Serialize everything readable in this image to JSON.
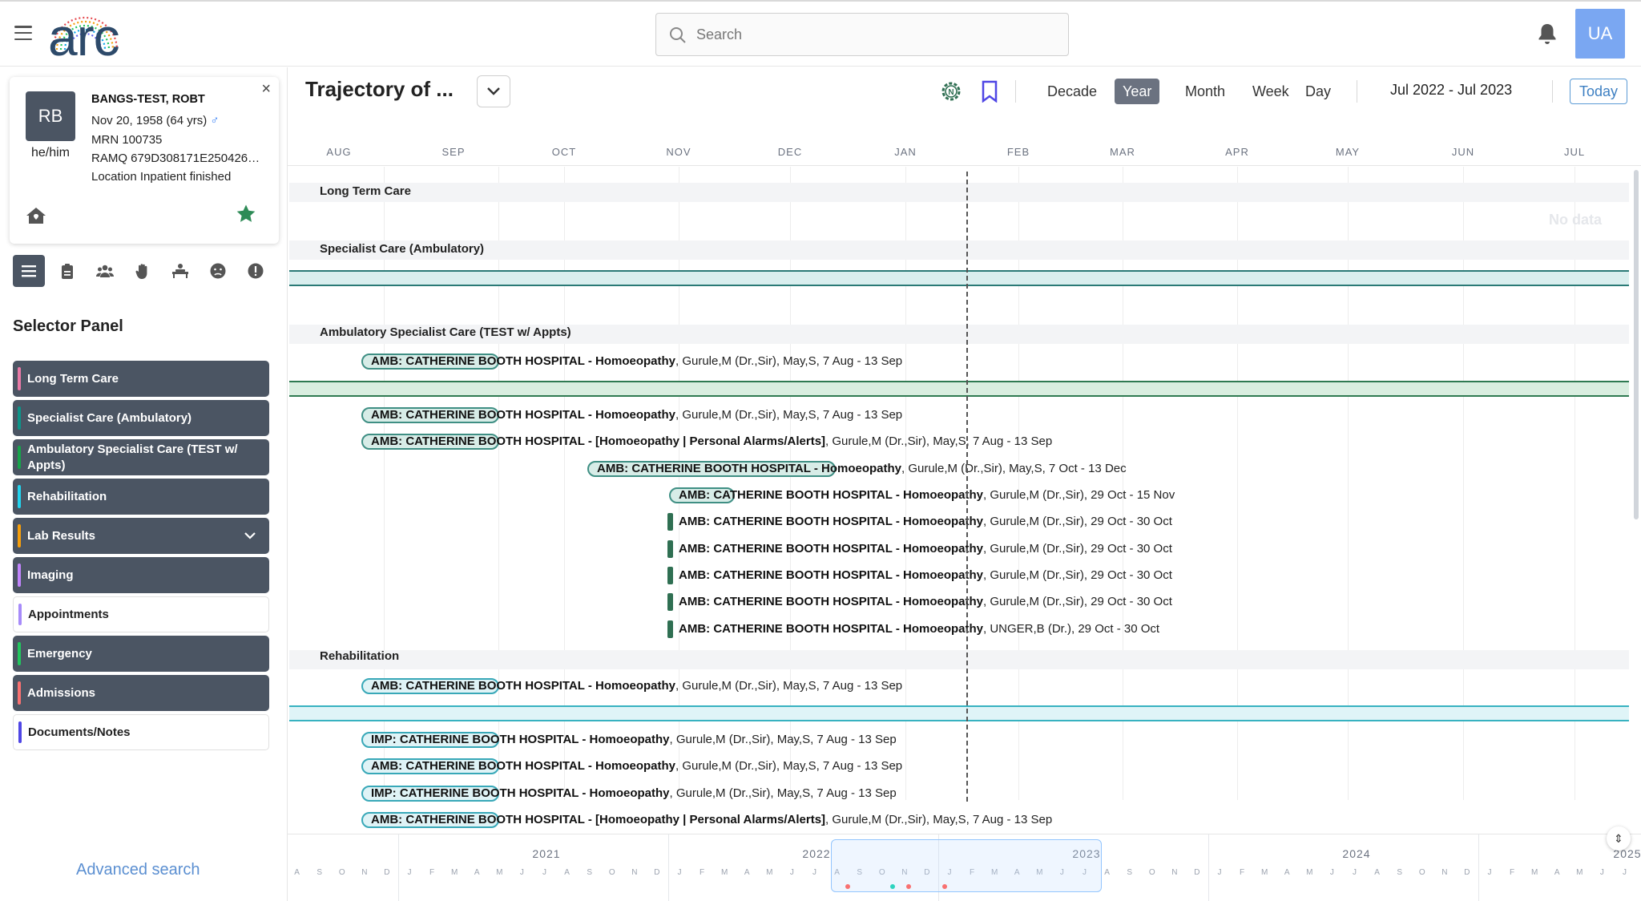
{
  "topbar": {
    "logo_text": "arc",
    "search_placeholder": "Search",
    "user_initials": "UA"
  },
  "patient": {
    "initials": "RB",
    "pronouns": "he/him",
    "name": "BANGS-TEST, ROBT",
    "dob": "Nov 20, 1958 (64 yrs)",
    "sex_symbol": "♂",
    "mrn": "MRN 100735",
    "ramq": "RAMQ 679D308171E250426…",
    "location": "Location Inpatient finished",
    "close_label": "×"
  },
  "sidebar": {
    "title": "Selector Panel",
    "advanced_search": "Advanced search",
    "items": [
      {
        "label": "Long Term Care",
        "color": "#e879a6",
        "style": "dark"
      },
      {
        "label": "Specialist Care (Ambulatory)",
        "color": "#0d9488",
        "style": "dark"
      },
      {
        "label": "Ambulatory Specialist Care (TEST w/ Appts)",
        "color": "#16a34a",
        "style": "dark"
      },
      {
        "label": "Rehabilitation",
        "color": "#22d3ee",
        "style": "dark"
      },
      {
        "label": "Lab Results",
        "color": "#f59e0b",
        "style": "dark"
      },
      {
        "label": "Imaging",
        "color": "#c084fc",
        "style": "dark"
      },
      {
        "label": "Appointments",
        "color": "#a78bfa",
        "style": "light"
      },
      {
        "label": "Emergency",
        "color": "#22c55e",
        "style": "dark"
      },
      {
        "label": "Admissions",
        "color": "#f87171",
        "style": "dark"
      },
      {
        "label": "Documents/Notes",
        "color": "#4f46e5",
        "style": "light"
      }
    ]
  },
  "toolbar": {
    "title": "Trajectory of ...",
    "zoom": [
      "Decade",
      "Year",
      "Month",
      "Week",
      "Day"
    ],
    "active_zoom": "Year",
    "range": "Jul 2022 - Jul 2023",
    "today_label": "Today"
  },
  "timeline": {
    "months": [
      "AUG",
      "SEP",
      "OCT",
      "NOV",
      "DEC",
      "JAN",
      "FEB",
      "MAR",
      "APR",
      "MAY",
      "JUN",
      "JUL"
    ],
    "no_data": "No data",
    "groups": [
      {
        "label": "Long Term Care"
      },
      {
        "label": "Specialist Care (Ambulatory)"
      },
      {
        "label": "Ambulatory Specialist Care (TEST w/ Appts)"
      },
      {
        "label": "Rehabilitation"
      }
    ],
    "events": [
      {
        "title": "AMB: CATHERINE BOOTH HOSPITAL - Homoeopathy",
        "detail": ", Gurule,M (Dr.,Sir), May,S, 7 Aug - 13 Sep",
        "color": "#3f8f84",
        "fill": "#d7ece7"
      },
      {
        "title": "AMB: CATHERINE BOOTH HOSPITAL - Homoeopathy",
        "detail": ", Gurule,M (Dr.,Sir), May,S, 7 Aug - 13 Sep",
        "color": "#3f8f84",
        "fill": "#d7ece7"
      },
      {
        "title": "AMB: CATHERINE BOOTH HOSPITAL - [Homoeopathy | Personal Alarms/Alerts]",
        "detail": ", Gurule,M (Dr.,Sir), May,S, 7 Aug - 13 Sep",
        "color": "#3f8f84",
        "fill": "#d7ece7"
      },
      {
        "title": "AMB: CATHERINE BOOTH HOSPITAL - Homoeopathy",
        "detail": ", Gurule,M (Dr.,Sir), May,S, 7 Oct - 13 Dec",
        "color": "#3f8f84",
        "fill": "#d7ece7"
      },
      {
        "title": "AMB: CATHERINE BOOTH HOSPITAL - Homoeopathy",
        "detail": ", Gurule,M (Dr.,Sir), 29 Oct - 15 Nov",
        "color": "#3f8f84",
        "fill": "#d7ece7"
      },
      {
        "title": "AMB: CATHERINE BOOTH HOSPITAL - Homoeopathy",
        "detail": ", Gurule,M (Dr.,Sir), 29 Oct - 30 Oct",
        "color": "#2f6f52",
        "fill": "#2f6f52"
      },
      {
        "title": "AMB: CATHERINE BOOTH HOSPITAL - Homoeopathy",
        "detail": ", Gurule,M (Dr.,Sir), 29 Oct - 30 Oct",
        "color": "#2f6f52",
        "fill": "#2f6f52"
      },
      {
        "title": "AMB: CATHERINE BOOTH HOSPITAL - Homoeopathy",
        "detail": ", Gurule,M (Dr.,Sir), 29 Oct - 30 Oct",
        "color": "#2f6f52",
        "fill": "#2f6f52"
      },
      {
        "title": "AMB: CATHERINE BOOTH HOSPITAL - Homoeopathy",
        "detail": ", Gurule,M (Dr.,Sir), 29 Oct - 30 Oct",
        "color": "#2f6f52",
        "fill": "#2f6f52"
      },
      {
        "title": "AMB: CATHERINE BOOTH HOSPITAL - Homoeopathy",
        "detail": ", UNGER,B (Dr.), 29 Oct - 30 Oct",
        "color": "#2f6f52",
        "fill": "#2f6f52"
      },
      {
        "title": "AMB: CATHERINE BOOTH HOSPITAL - Homoeopathy",
        "detail": ", Gurule,M (Dr.,Sir), May,S, 7 Aug - 13 Sep",
        "color": "#38a8b8",
        "fill": "#dff3f6"
      },
      {
        "title": "IMP: CATHERINE BOOTH HOSPITAL - Homoeopathy",
        "detail": ", Gurule,M (Dr.,Sir), May,S, 7 Aug - 13 Sep",
        "color": "#38a8b8",
        "fill": "#dff3f6"
      },
      {
        "title": "AMB: CATHERINE BOOTH HOSPITAL - Homoeopathy",
        "detail": ", Gurule,M (Dr.,Sir), May,S, 7 Aug - 13 Sep",
        "color": "#38a8b8",
        "fill": "#dff3f6"
      },
      {
        "title": "IMP: CATHERINE BOOTH HOSPITAL - Homoeopathy",
        "detail": ", Gurule,M (Dr.,Sir), May,S, 7 Aug - 13 Sep",
        "color": "#38a8b8",
        "fill": "#dff3f6"
      },
      {
        "title": "AMB: CATHERINE BOOTH HOSPITAL - [Homoeopathy | Personal Alarms/Alerts]",
        "detail": ", Gurule,M (Dr.,Sir), May,S, 7 Aug - 13 Sep",
        "color": "#38a8b8",
        "fill": "#dff3f6"
      }
    ]
  },
  "overview": {
    "years": [
      "2021",
      "2022",
      "2023",
      "2024",
      "2025"
    ],
    "month_initials": [
      "J",
      "F",
      "M",
      "A",
      "M",
      "J",
      "J",
      "A",
      "S",
      "O",
      "N",
      "D"
    ]
  }
}
